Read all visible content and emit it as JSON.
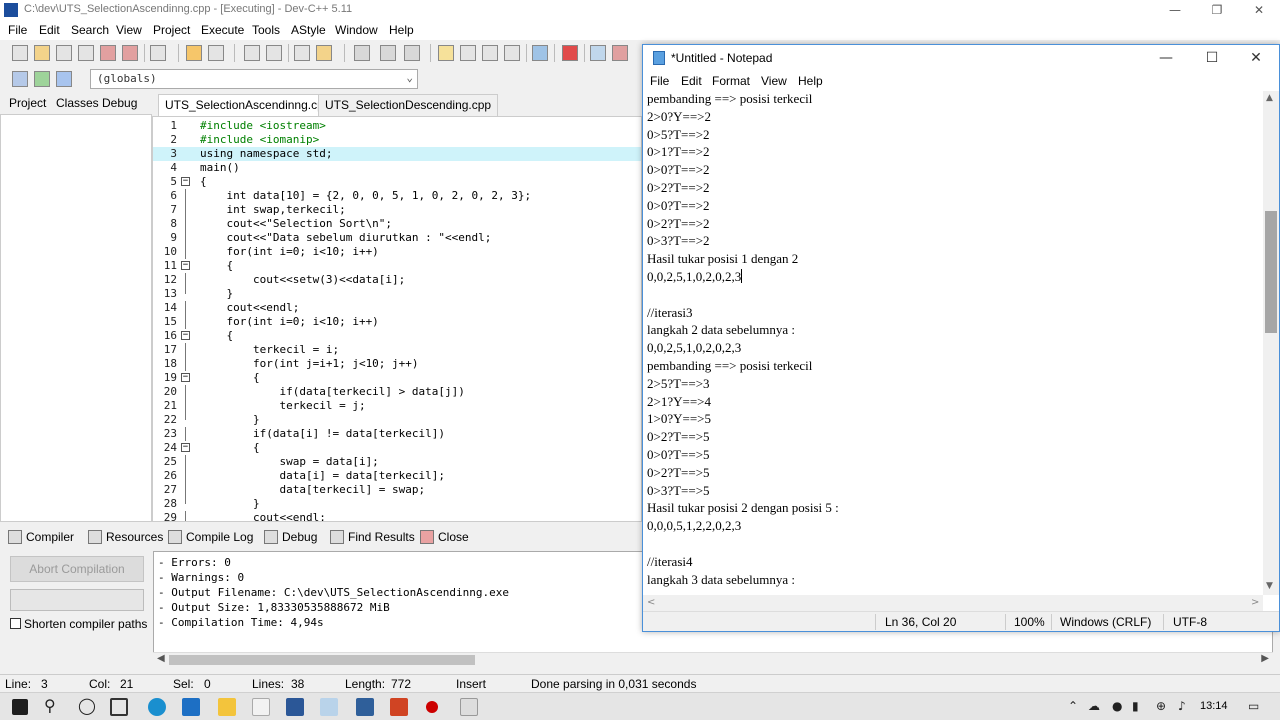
{
  "devcpp": {
    "title": "C:\\dev\\UTS_SelectionAscendinng.cpp - [Executing] - Dev-C++ 5.11",
    "menu": [
      "File",
      "Edit",
      "Search",
      "View",
      "Project",
      "Execute",
      "Tools",
      "AStyle",
      "Window",
      "Help"
    ],
    "scope_select": "(globals)",
    "left_tabs": [
      "Project",
      "Classes",
      "Debug"
    ],
    "editor_tabs": [
      "UTS_SelectionAscendinng.cpp",
      "UTS_SelectionDescending.cpp"
    ],
    "code_lines": [
      "#include <iostream>",
      "#include <iomanip>",
      "using namespace std;",
      "main()",
      "{",
      "    int data[10] = {2, 0, 0, 5, 1, 0, 2, 0, 2, 3};",
      "    int swap,terkecil;",
      "    cout<<\"Selection Sort\\n\";",
      "    cout<<\"Data sebelum diurutkan : \"<<endl;",
      "    for(int i=0; i<10; i++)",
      "    {",
      "        cout<<setw(3)<<data[i];",
      "    }",
      "    cout<<endl;",
      "    for(int i=0; i<10; i++)",
      "    {",
      "        terkecil = i;",
      "        for(int j=i+1; j<10; j++)",
      "        {",
      "            if(data[terkecil] > data[j])",
      "            terkecil = j;",
      "        }",
      "        if(data[i] != data[terkecil])",
      "        {",
      "            swap = data[i];",
      "            data[i] = data[terkecil];",
      "            data[terkecil] = swap;",
      "        }",
      "        cout<<endl;"
    ],
    "bottom_tabs": [
      "Compiler",
      "Resources",
      "Compile Log",
      "Debug",
      "Find Results",
      "Close"
    ],
    "abort_label": "Abort Compilation",
    "shorten_label": "Shorten compiler paths",
    "compile_log": [
      "- Errors: 0",
      "- Warnings: 0",
      "- Output Filename: C:\\dev\\UTS_SelectionAscendinng.exe",
      "- Output Size: 1,83330535888672 MiB",
      "- Compilation Time: 4,94s"
    ],
    "status": {
      "line_label": "Line:",
      "line_value": "3",
      "col_label": "Col:",
      "col_value": "21",
      "sel_label": "Sel:",
      "sel_value": "0",
      "lines_label": "Lines:",
      "lines_value": "38",
      "length_label": "Length:",
      "length_value": "772",
      "mode": "Insert",
      "message": "Done parsing in 0,031 seconds"
    }
  },
  "notepad": {
    "title": "*Untitled - Notepad",
    "menu": [
      "File",
      "Edit",
      "Format",
      "View",
      "Help"
    ],
    "lines": [
      "pembanding ==> posisi terkecil",
      "2>0?Y==>2",
      "0>5?T==>2",
      "0>1?T==>2",
      "0>0?T==>2",
      "0>2?T==>2",
      "0>0?T==>2",
      "0>2?T==>2",
      "0>3?T==>2",
      "Hasil tukar posisi 1 dengan 2",
      "0,0,2,5,1,0,2,0,2,3",
      "",
      "//iterasi3",
      "langkah 2 data sebelumnya :",
      "0,0,2,5,1,0,2,0,2,3",
      "pembanding ==> posisi terkecil",
      "2>5?T==>3",
      "2>1?Y==>4",
      "1>0?Y==>5",
      "0>2?T==>5",
      "0>0?T==>5",
      "0>2?T==>5",
      "0>3?T==>5",
      "Hasil tukar posisi 2 dengan posisi 5 :",
      "0,0,0,5,1,2,2,0,2,3",
      "",
      "//iterasi4",
      "langkah 3 data sebelumnya :"
    ],
    "status": {
      "position": "Ln 36, Col 20",
      "zoom": "100%",
      "line_ending": "Windows (CRLF)",
      "encoding": "UTF-8"
    }
  },
  "taskbar": {
    "clock": "13:14"
  }
}
